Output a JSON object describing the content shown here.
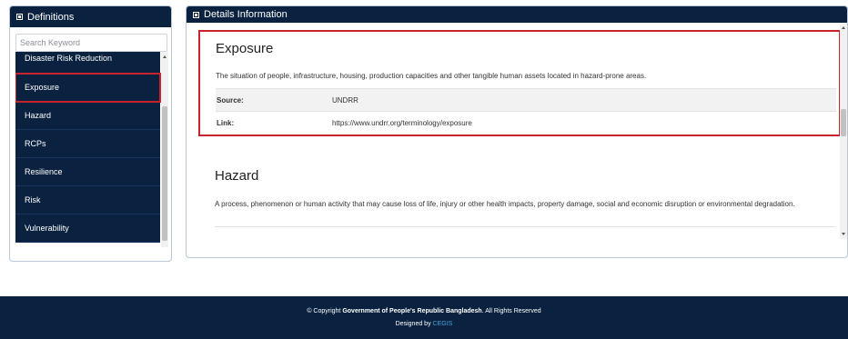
{
  "definitions": {
    "title": "Definitions",
    "search_placeholder": "Search Keyword",
    "items": [
      {
        "label": "Disaster Risk Reduction"
      },
      {
        "label": "Exposure"
      },
      {
        "label": "Hazard"
      },
      {
        "label": "RCPs"
      },
      {
        "label": "Resilience"
      },
      {
        "label": "Risk"
      },
      {
        "label": "Vulnerability"
      }
    ],
    "selected": "Exposure"
  },
  "details": {
    "title": "Details Information",
    "terms": [
      {
        "title": "Exposure",
        "description": "The situation of people, infrastructure, housing, production capacities and other tangible human assets located in hazard-prone areas.",
        "source_label": "Source:",
        "source_value": "UNDRR",
        "link_label": "Link:",
        "link_value": "https://www.undrr.org/terminology/exposure"
      },
      {
        "title": "Hazard",
        "description": "A process, phenomenon or human activity that may cause loss of life, injury or other health impacts, property damage, social and economic disruption or environmental degradation."
      }
    ]
  },
  "footer": {
    "copyright_prefix": "© Copyright",
    "copyright_owner": "Government of People's Republic Bangladesh",
    "copyright_suffix": ". All Rights Reserved",
    "designed_by": "Designed by",
    "designer": "CEGIS"
  },
  "colors": {
    "navy": "#0a2240",
    "highlight_red": "#c8232c",
    "link_blue": "#4aa3df"
  }
}
